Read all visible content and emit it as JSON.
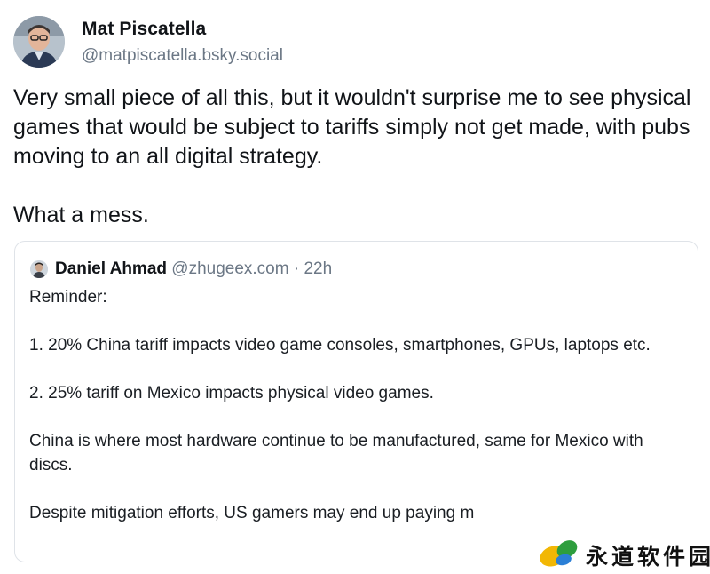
{
  "author": {
    "name": "Mat Piscatella",
    "handle": "@matpiscatella.bsky.social"
  },
  "post": {
    "paragraphs": [
      "Very small piece of all this, but it wouldn't surprise me to see physical games that would be subject to tariffs simply not get made, with pubs moving to an all digital strategy.",
      "What a mess."
    ]
  },
  "quote": {
    "author_name": "Daniel Ahmad",
    "author_handle": "@zhugeex.com",
    "separator": "·",
    "time": "22h",
    "paragraphs": [
      "Reminder:",
      "1. 20% China tariff impacts video game consoles, smartphones, GPUs, laptops etc.",
      "2. 25% tariff on Mexico impacts physical video games.",
      "China is where most hardware continue to be manufactured, same for Mexico with discs.",
      "Despite mitigation efforts, US gamers may end up paying m"
    ]
  },
  "watermark": {
    "text": "永道软件园"
  },
  "colors": {
    "text": "#111418",
    "muted": "#6b7785",
    "card_border": "#dfe3e8"
  }
}
